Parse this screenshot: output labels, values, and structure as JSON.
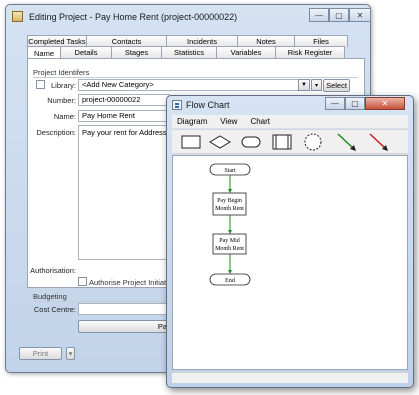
{
  "editing_window": {
    "title": "Editing Project - Pay Home Rent (project-00000022)",
    "tabs_row1": [
      "Completed Tasks",
      "Contacts",
      "Incidents",
      "Notes",
      "Files"
    ],
    "tabs_row2": [
      "Name",
      "Details",
      "Stages",
      "Statistics",
      "Variables",
      "Risk Register"
    ],
    "active_tab": "Name",
    "section_identifiers": "Project Identifers",
    "library_label": "Library:",
    "library_value": "<Add New Category>",
    "select_button": "Select",
    "number_label": "Number:",
    "number_value": "project-00000022",
    "name_label": "Name:",
    "name_value": "Pay Home Rent",
    "description_label": "Description:",
    "description_value": "Pay your rent for Address",
    "authorisation_label": "Authorisation:",
    "authorise_checkbox_label": "Authorise Project Initiation",
    "budgeting_label": "Budgeting",
    "cost_centre_label": "Cost Centre:",
    "pa_button": "Pa",
    "print_button": "Print",
    "print_dropdown_glyph": "▾"
  },
  "flowchart_window": {
    "title": "Flow Chart",
    "menu": [
      "Diagram",
      "View",
      "Chart"
    ],
    "tools": [
      "rectangle-tool",
      "diamond-tool",
      "rounded-rect-tool",
      "process-tool",
      "connector-circle-tool",
      "green-arrow-tool",
      "red-arrow-tool"
    ],
    "nodes": [
      {
        "type": "terminal",
        "text": [
          "Start"
        ]
      },
      {
        "type": "process",
        "text": [
          "Pay Begin",
          "Month Rent"
        ]
      },
      {
        "type": "process",
        "text": [
          "Pay Mid",
          "Month Rent"
        ]
      },
      {
        "type": "terminal",
        "text": [
          "End"
        ]
      }
    ],
    "connector_color": "#1e8a1e"
  },
  "caption_glyphs": {
    "minimize": "—",
    "maximize": "▢",
    "close": "✕"
  }
}
